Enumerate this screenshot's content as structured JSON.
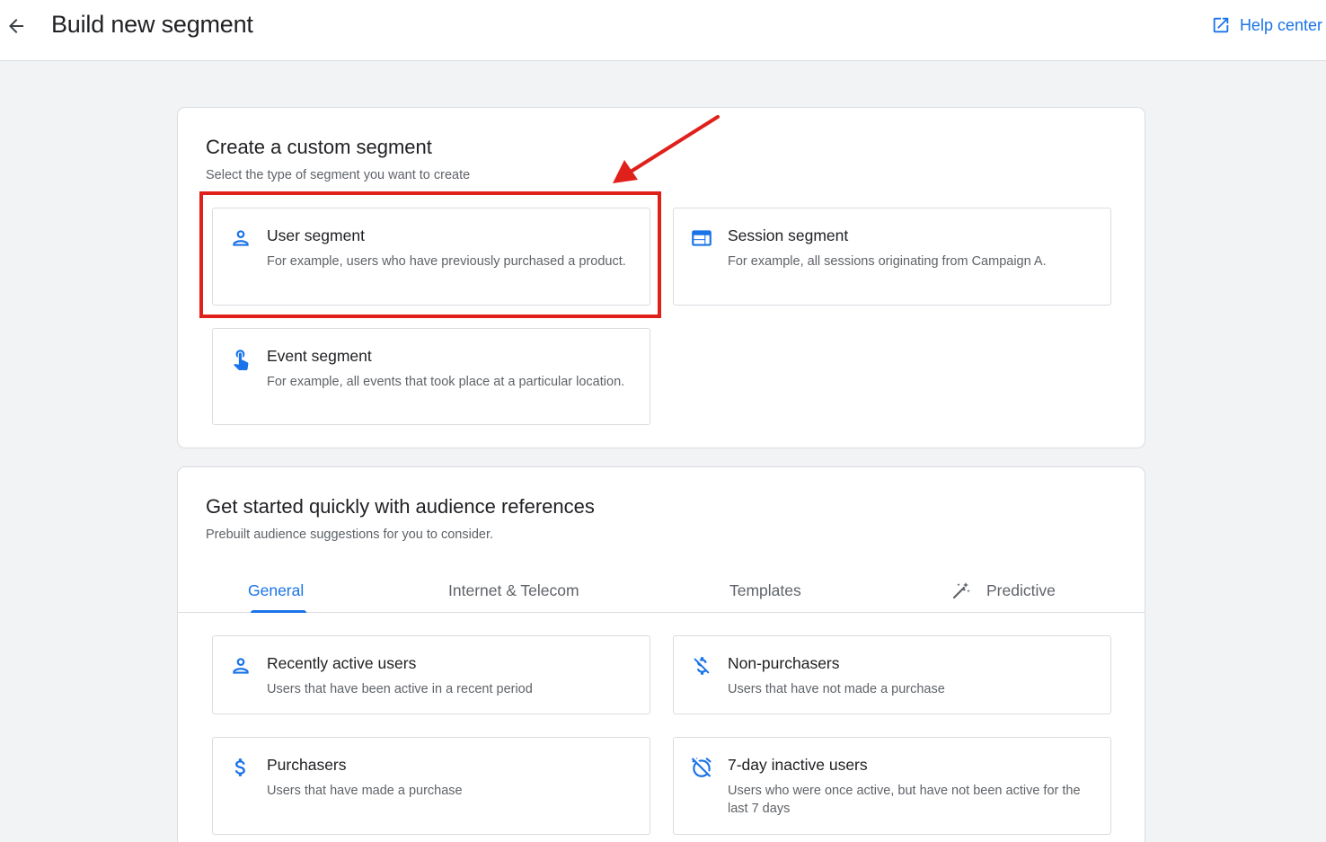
{
  "header": {
    "title": "Build new segment",
    "help_label": "Help center"
  },
  "custom_segment": {
    "title": "Create a custom segment",
    "subtitle": "Select the type of segment you want to create",
    "options": [
      {
        "title": "User segment",
        "description": "For example, users who have previously purchased a product.",
        "icon": "person-icon"
      },
      {
        "title": "Session segment",
        "description": "For example, all sessions originating from Campaign A.",
        "icon": "web-icon"
      },
      {
        "title": "Event segment",
        "description": "For example, all events that took place at a particular location.",
        "icon": "touch-icon"
      }
    ]
  },
  "audience_refs": {
    "title": "Get started quickly with audience references",
    "subtitle": "Prebuilt audience suggestions for you to consider.",
    "tabs": [
      {
        "label": "General",
        "active": true
      },
      {
        "label": "Internet & Telecom",
        "active": false
      },
      {
        "label": "Templates",
        "active": false
      },
      {
        "label": "Predictive",
        "active": false,
        "icon": "magic-wand-icon"
      }
    ],
    "items": [
      {
        "title": "Recently active users",
        "description": "Users that have been active in a recent period",
        "icon": "person-icon"
      },
      {
        "title": "Non-purchasers",
        "description": "Users that have not made a purchase",
        "icon": "money-off-icon"
      },
      {
        "title": "Purchasers",
        "description": "Users that have made a purchase",
        "icon": "dollar-icon"
      },
      {
        "title": "7-day inactive users",
        "description": "Users who were once active, but have not been active for the last 7 days",
        "icon": "alarm-off-icon"
      }
    ]
  },
  "colors": {
    "accent": "#1a73e8",
    "annotation": "#e0201b"
  }
}
